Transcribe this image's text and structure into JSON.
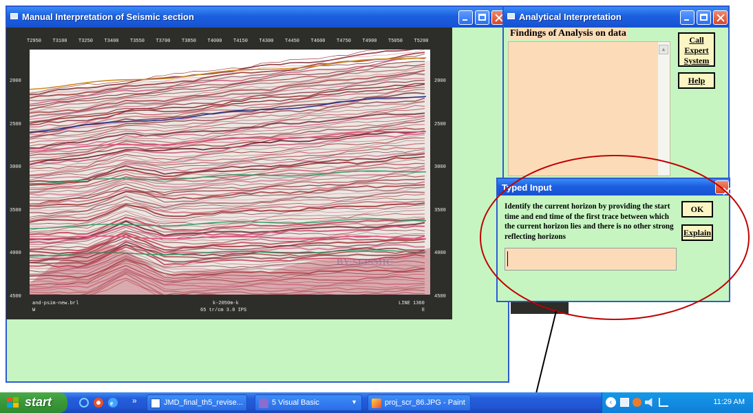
{
  "seismic_window": {
    "title": "Manual Interpretation of Seismic section",
    "trace_labels": [
      "T2950",
      "T3100",
      "T3250",
      "T3400",
      "T3550",
      "T3700",
      "T3850",
      "T4000",
      "T4150",
      "T4300",
      "T4450",
      "T4600",
      "T4750",
      "T4900",
      "T5050",
      "T5200"
    ],
    "time_labels_left": [
      "2000",
      "2500",
      "3000",
      "3500",
      "4000",
      "4500"
    ],
    "time_labels_right": [
      "2000",
      "2500",
      "3000",
      "3500",
      "4000",
      "4500"
    ],
    "footer_left": "and-psim-new.brl",
    "footer_left2": "W",
    "footer_center": "k-2050m-k",
    "footer_center2": "65 tr/cm 3.0 IPS",
    "footer_right": "LINE 1360",
    "footer_right2": "E",
    "watermark": "BY:SEISMIC"
  },
  "analysis_window": {
    "title": "Analytical Interpretation",
    "findings_label": "Findings of Analysis on data",
    "call_button": "Call Expert System",
    "help_button": "Help"
  },
  "dialog": {
    "title": "Typed Input",
    "prompt": "Identify the current horizon by providing the start time and end time of the first trace between which the current horizon lies and there is no other strong reflecting horizons",
    "ok_button": "OK",
    "explain_button": "Explain",
    "input_value": ""
  },
  "taskbar": {
    "start_label": "start",
    "overflow": "»",
    "items": [
      {
        "label": "JMD_final_th5_revise...",
        "icon": "word-icon"
      },
      {
        "label": "5 Visual Basic",
        "icon": "visual-basic-icon"
      },
      {
        "label": "proj_scr_86.JPG - Paint",
        "icon": "paint-icon"
      }
    ],
    "clock": "11:29 AM"
  },
  "colors": {
    "window_bg": "#c6f5c1",
    "title_blue": "#1b5fe0",
    "findings_bg": "#fcdcb8",
    "button_bg": "#fbf5c3",
    "annotation_red": "#c00000"
  }
}
